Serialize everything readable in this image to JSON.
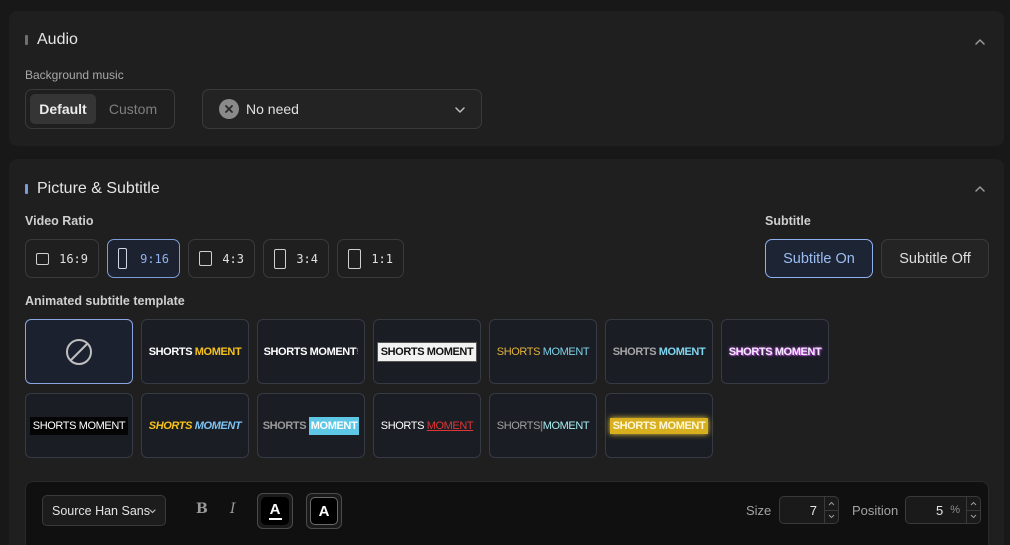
{
  "audio": {
    "title": "Audio",
    "background_music_label": "Background music",
    "music_source": {
      "default_label": "Default",
      "custom_label": "Custom",
      "selected": "Default"
    },
    "music_select": {
      "value": "No need",
      "icon": "x-circle-icon"
    }
  },
  "picture": {
    "title": "Picture & Subtitle",
    "video_ratio_label": "Video Ratio",
    "ratios": [
      {
        "label": "16:9",
        "active": false
      },
      {
        "label": "9:16",
        "active": true
      },
      {
        "label": "4:3",
        "active": false
      },
      {
        "label": "3:4",
        "active": false
      },
      {
        "label": "1:1",
        "active": false
      }
    ],
    "subtitle_label": "Subtitle",
    "subtitle_on_label": "Subtitle On",
    "subtitle_off_label": "Subtitle Off",
    "subtitle_selected": "Subtitle On",
    "template_label": "Animated subtitle template",
    "templates": [
      {
        "text1": "",
        "text2": "",
        "icon": "no-template-icon",
        "active": true
      },
      {
        "text1": "SHORTS",
        "text2": "MOMENT",
        "active": false
      },
      {
        "text1": "SHORTS",
        "text2": "MOMENT",
        "badge": "!",
        "active": false
      },
      {
        "text1": "SHORTS",
        "text2": "MOMENT",
        "active": false
      },
      {
        "text1": "SHORTS",
        "text2": "MOMENT",
        "active": false
      },
      {
        "text1": "SHORTS",
        "text2": "MOMENT",
        "active": false
      },
      {
        "text1": "SHORTS",
        "text2": "MOMENT",
        "active": false
      },
      {
        "text1": "SHORTS",
        "text2": "MOMENT",
        "active": false
      },
      {
        "text1": "SHORTS",
        "text2": "MOMENT",
        "active": false
      },
      {
        "text1": "SHORTS",
        "text2": "MOMENT",
        "active": false
      },
      {
        "text1": "SHORTS",
        "text2": "MOMENT",
        "active": false
      },
      {
        "text1": "SHORTS",
        "text2": "MOMENT",
        "active": false
      },
      {
        "text1": "SHORTS",
        "text2": "MOMENT",
        "active": false
      }
    ],
    "text_style": {
      "font": "Source Han Sans",
      "bold_label": "B",
      "italic_label": "I",
      "text_color_label": "A",
      "stroke_color_label": "A",
      "size_label": "Size",
      "size_value": "7",
      "position_label": "Position",
      "position_value": "5",
      "position_unit": "%"
    }
  },
  "colors": {
    "accent": "#8fb0ee",
    "panel_bg": "#1f1f1f",
    "page_bg": "#181818",
    "audio_bar": "#6f6f6f",
    "picture_bar": "#7d9bd8"
  }
}
